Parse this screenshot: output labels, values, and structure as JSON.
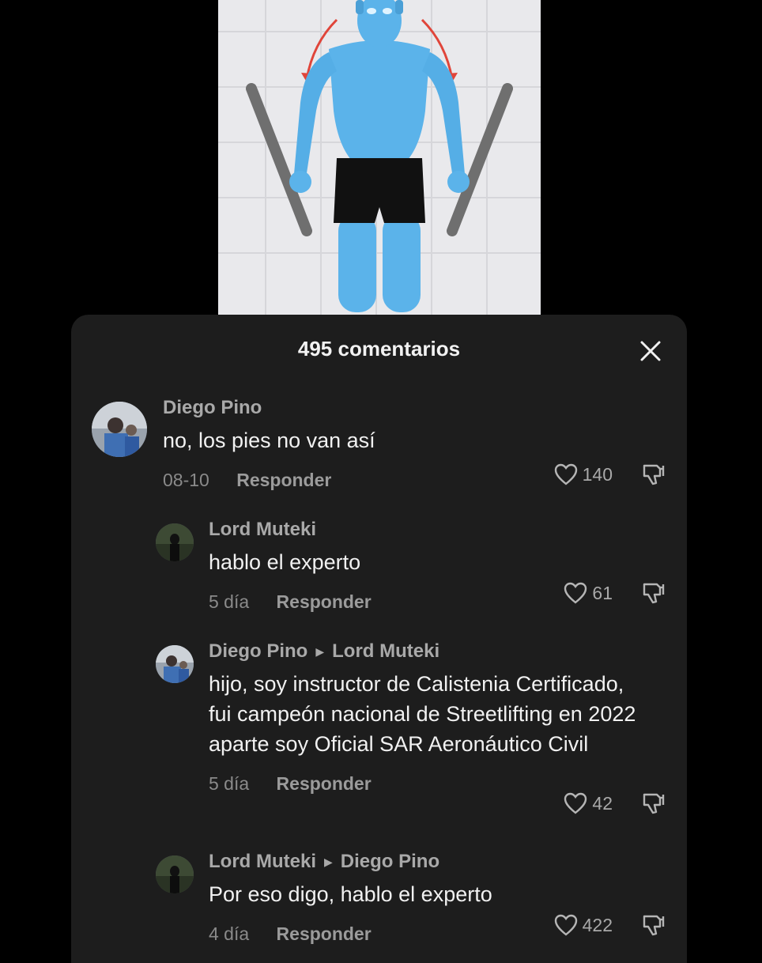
{
  "sheet": {
    "title": "495 comentarios"
  },
  "comments": [
    {
      "author": "Diego Pino",
      "reply_to": "",
      "text": "no, los pies no van así",
      "date": "08-10",
      "reply_label": "Responder",
      "likes": "140"
    },
    {
      "author": "Lord Muteki",
      "reply_to": "",
      "text": "hablo el experto",
      "date": "5 día",
      "reply_label": "Responder",
      "likes": "61"
    },
    {
      "author": "Diego Pino",
      "reply_to": "Lord Muteki",
      "text": "hijo, soy instructor de Calistenia Certificado, fui campeón nacional de Streetlifting en 2022 aparte soy Oficial SAR Aeronáutico Civil",
      "date": "5 día",
      "reply_label": "Responder",
      "likes": "42"
    },
    {
      "author": "Lord Muteki",
      "reply_to": "Diego Pino",
      "text": "Por eso digo, hablo el experto",
      "date": "4 día",
      "reply_label": "Responder",
      "likes": "422"
    }
  ],
  "icons": {
    "close": "close-icon",
    "like": "heart-icon",
    "dislike": "thumbs-down-icon",
    "reply_arrow": "triangle-right-icon"
  },
  "colors": {
    "sheet_bg": "#1d1d1d",
    "figure": "#5bb3ea",
    "shorts": "#111111",
    "arrow_red": "#e0453a"
  }
}
